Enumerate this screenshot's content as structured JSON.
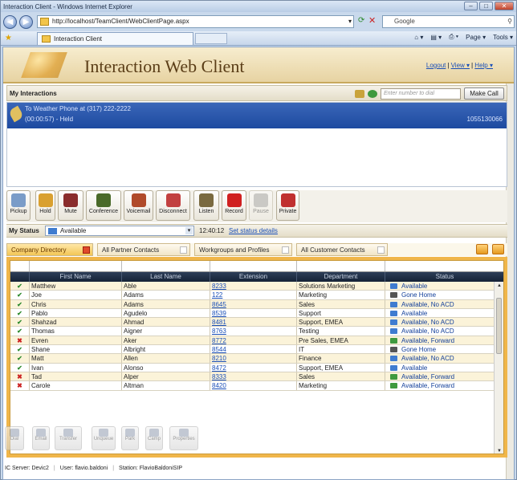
{
  "window": {
    "title": "Interaction Client - Windows Internet Explorer"
  },
  "browser": {
    "url": "http://localhost/TeamClient/WebClientPage.aspx",
    "search_text": "Google",
    "tab_title": "Interaction Client",
    "tools": [
      "Page ▾",
      "Tools ▾"
    ]
  },
  "app": {
    "title": "Interaction Web Client",
    "links": {
      "logout": "Logout",
      "view": "View ▾",
      "help": "Help ▾"
    }
  },
  "interactions": {
    "heading": "My Interactions",
    "dial_placeholder": "Enter number to dial",
    "make_call": "Make Call",
    "call": {
      "title": "To Weather Phone at (317) 222-2222",
      "status": "(00:00:57) - Held",
      "id": "1055130066",
      "badge": "3"
    }
  },
  "toolbar": {
    "buttons": [
      {
        "label": "Pickup",
        "color": "#7a9cc8"
      },
      {
        "label": "Hold",
        "color": "#d9a030"
      },
      {
        "label": "Mute",
        "color": "#8a2c2c"
      },
      {
        "label": "Conference",
        "color": "#4a6a2a"
      },
      {
        "label": "Voicemail",
        "color": "#b04a2a"
      },
      {
        "label": "Disconnect",
        "color": "#c24040"
      },
      {
        "label": "Listen",
        "color": "#7a6a40"
      },
      {
        "label": "Record",
        "color": "#d02020"
      },
      {
        "label": "Pause",
        "color": "#9a9a9a"
      },
      {
        "label": "Private",
        "color": "#c03030"
      }
    ]
  },
  "status": {
    "label": "My Status",
    "value": "Available",
    "time": "12:40:12",
    "link": "Set status details"
  },
  "directory_tabs": [
    "Company Directory",
    "All Partner Contacts",
    "Workgroups and Profiles",
    "All Customer Contacts"
  ],
  "directory": {
    "columns": [
      "",
      "First Name",
      "Last Name",
      "Extension",
      "Department",
      "Status"
    ],
    "rows": [
      {
        "ok": true,
        "first": "Matthew",
        "last": "Able",
        "ext": "8233",
        "dept": "Solutions Marketing",
        "status": "Available",
        "icon": "#3f7cd0"
      },
      {
        "ok": true,
        "first": "Joe",
        "last": "Adams",
        "ext": "122",
        "dept": "Marketing",
        "status": "Gone Home",
        "icon": "#555"
      },
      {
        "ok": true,
        "first": "Chris",
        "last": "Adams",
        "ext": "8645",
        "dept": "Sales",
        "status": "Available, No ACD",
        "icon": "#3f7cd0"
      },
      {
        "ok": true,
        "first": "Pablo",
        "last": "Agudelo",
        "ext": "8539",
        "dept": "Support",
        "status": "Available",
        "icon": "#3f7cd0"
      },
      {
        "ok": true,
        "first": "Shahzad",
        "last": "Ahmad",
        "ext": "8481",
        "dept": "Support, EMEA",
        "status": "Available, No ACD",
        "icon": "#3f7cd0"
      },
      {
        "ok": true,
        "first": "Thomas",
        "last": "Aigner",
        "ext": "8763",
        "dept": "Testing",
        "status": "Available, No ACD",
        "icon": "#3f7cd0"
      },
      {
        "ok": false,
        "first": "Evren",
        "last": "Aker",
        "ext": "8772",
        "dept": "Pre Sales, EMEA",
        "status": "Available, Forward",
        "icon": "#3f9a3f"
      },
      {
        "ok": true,
        "first": "Shane",
        "last": "Albright",
        "ext": "8544",
        "dept": "IT",
        "status": "Gone Home",
        "icon": "#555"
      },
      {
        "ok": true,
        "first": "Matt",
        "last": "Allen",
        "ext": "8210",
        "dept": "Finance",
        "status": "Available, No ACD",
        "icon": "#3f7cd0"
      },
      {
        "ok": true,
        "first": "Ivan",
        "last": "Alonso",
        "ext": "8472",
        "dept": "Support, EMEA",
        "status": "Available",
        "icon": "#3f7cd0"
      },
      {
        "ok": false,
        "first": "Tad",
        "last": "Alper",
        "ext": "8333",
        "dept": "Sales",
        "status": "Available, Forward",
        "icon": "#3f9a3f"
      },
      {
        "ok": false,
        "first": "Carole",
        "last": "Altman",
        "ext": "8420",
        "dept": "Marketing",
        "status": "Available, Forward",
        "icon": "#3f9a3f"
      }
    ]
  },
  "bottom_toolbar": [
    "Dial",
    "Email",
    "Transfer",
    "Unqueue",
    "Park",
    "Camp",
    "Properties"
  ],
  "statusbar": {
    "server": "IC Server: Devic2",
    "user": "User: flavio.baldoni",
    "station": "Station: FlavioBaldoniSIP"
  }
}
